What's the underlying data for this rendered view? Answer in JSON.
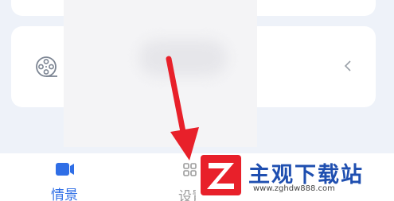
{
  "tabbar": {
    "scene_label": "情景",
    "settings_label": "设置"
  },
  "icons": {
    "reel": "film-reel-icon",
    "chevron": "chevron-left-icon",
    "scene": "video-camera-icon",
    "settings": "settings-grid-icon"
  },
  "watermark": {
    "title": "主观下载站",
    "url": "www.zghdw888.com"
  },
  "colors": {
    "background": "#eef2f9",
    "accent": "#2f6ee6",
    "arrow": "#e8202a",
    "watermark": "#1f4fb0"
  }
}
